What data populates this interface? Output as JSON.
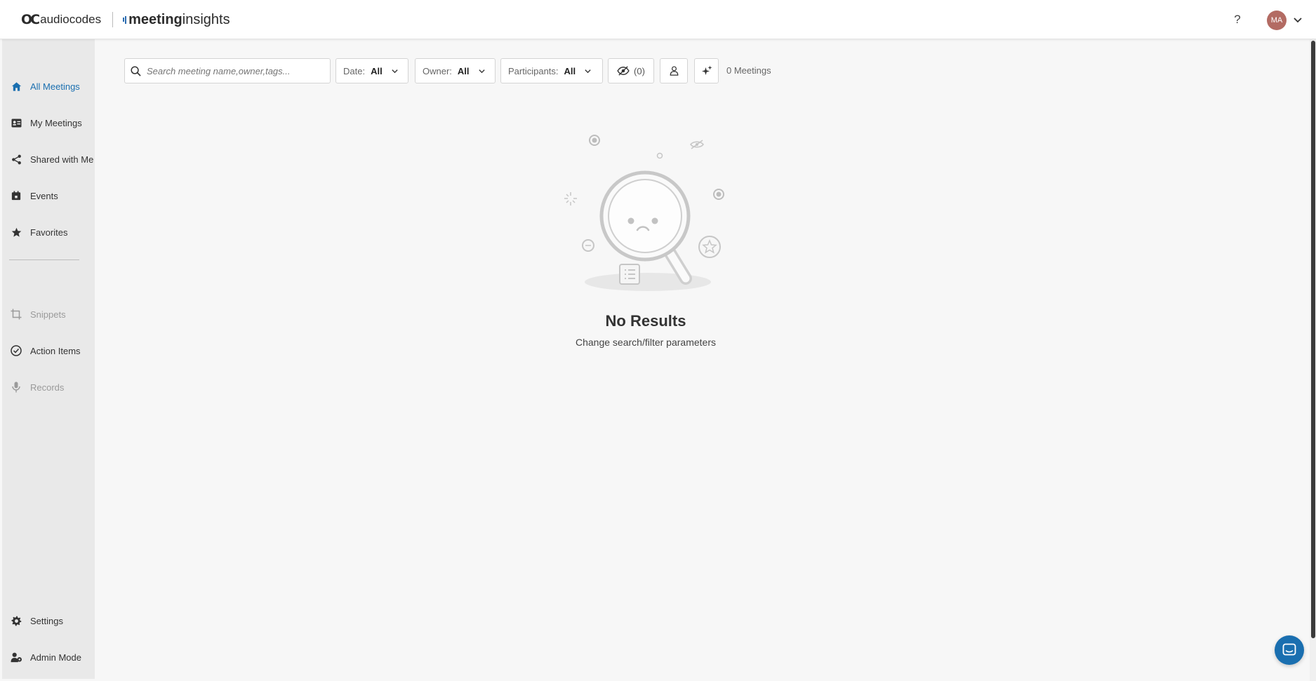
{
  "header": {
    "brand_company": "audiocodes",
    "brand_app_bold": "meeting",
    "brand_app_light": "insights",
    "help_label": "?",
    "avatar_initials": "MA"
  },
  "sidebar": {
    "items": [
      {
        "label": "All Meetings",
        "icon": "home-icon",
        "state": "active"
      },
      {
        "label": "My Meetings",
        "icon": "id-card-icon",
        "state": "normal"
      },
      {
        "label": "Shared with Me",
        "icon": "share-icon",
        "state": "normal"
      },
      {
        "label": "Events",
        "icon": "calendar-icon",
        "state": "normal"
      },
      {
        "label": "Favorites",
        "icon": "star-icon",
        "state": "normal"
      },
      {
        "label": "Snippets",
        "icon": "crop-icon",
        "state": "disabled"
      },
      {
        "label": "Action Items",
        "icon": "check-circle-icon",
        "state": "normal"
      },
      {
        "label": "Records",
        "icon": "microphone-icon",
        "state": "disabled"
      }
    ],
    "bottom_items": [
      {
        "label": "Settings",
        "icon": "gear-icon"
      },
      {
        "label": "Admin Mode",
        "icon": "admin-users-icon"
      }
    ]
  },
  "toolbar": {
    "search_placeholder": "Search meeting name,owner,tags...",
    "filters": [
      {
        "key": "Date:",
        "value": "All"
      },
      {
        "key": "Owner:",
        "value": "All"
      },
      {
        "key": "Participants:",
        "value": "All"
      }
    ],
    "hidden_count": "(0)",
    "meetings_count": "0 Meetings"
  },
  "empty_state": {
    "title": "No Results",
    "subtitle": "Change search/filter parameters"
  },
  "colors": {
    "accent": "#1a6fb0",
    "sidebar_bg": "#e9e9e9",
    "page_bg": "#f7f7f7",
    "avatar": "#b36b63"
  }
}
